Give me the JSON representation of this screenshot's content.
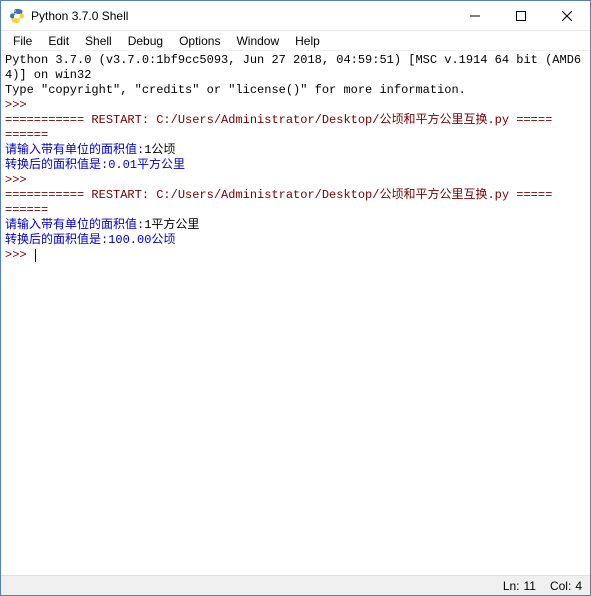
{
  "window": {
    "title": "Python 3.7.0 Shell"
  },
  "menu": {
    "items": [
      "File",
      "Edit",
      "Shell",
      "Debug",
      "Options",
      "Window",
      "Help"
    ]
  },
  "console": {
    "banner_line1": "Python 3.7.0 (v3.7.0:1bf9cc5093, Jun 27 2018, 04:59:51) [MSC v.1914 64 bit (AMD64)] on win32",
    "banner_line2": "Type \"copyright\", \"credits\" or \"license()\" for more information.",
    "prompt": ">>>",
    "restart_line": "=========== RESTART: C:/Users/Administrator/Desktop/公顷和平方公里互换.py =====\n======",
    "run1": {
      "input_prompt": "请输入带有单位的面积值:",
      "input_value": "1公顷",
      "output": "转换后的面积值是:0.01平方公里"
    },
    "run2": {
      "input_prompt": "请输入带有单位的面积值:",
      "input_value": "1平方公里",
      "output": "转换后的面积值是:100.00公顷"
    }
  },
  "status": {
    "ln_label": "Ln:",
    "ln_value": "11",
    "col_label": "Col:",
    "col_value": "4"
  }
}
